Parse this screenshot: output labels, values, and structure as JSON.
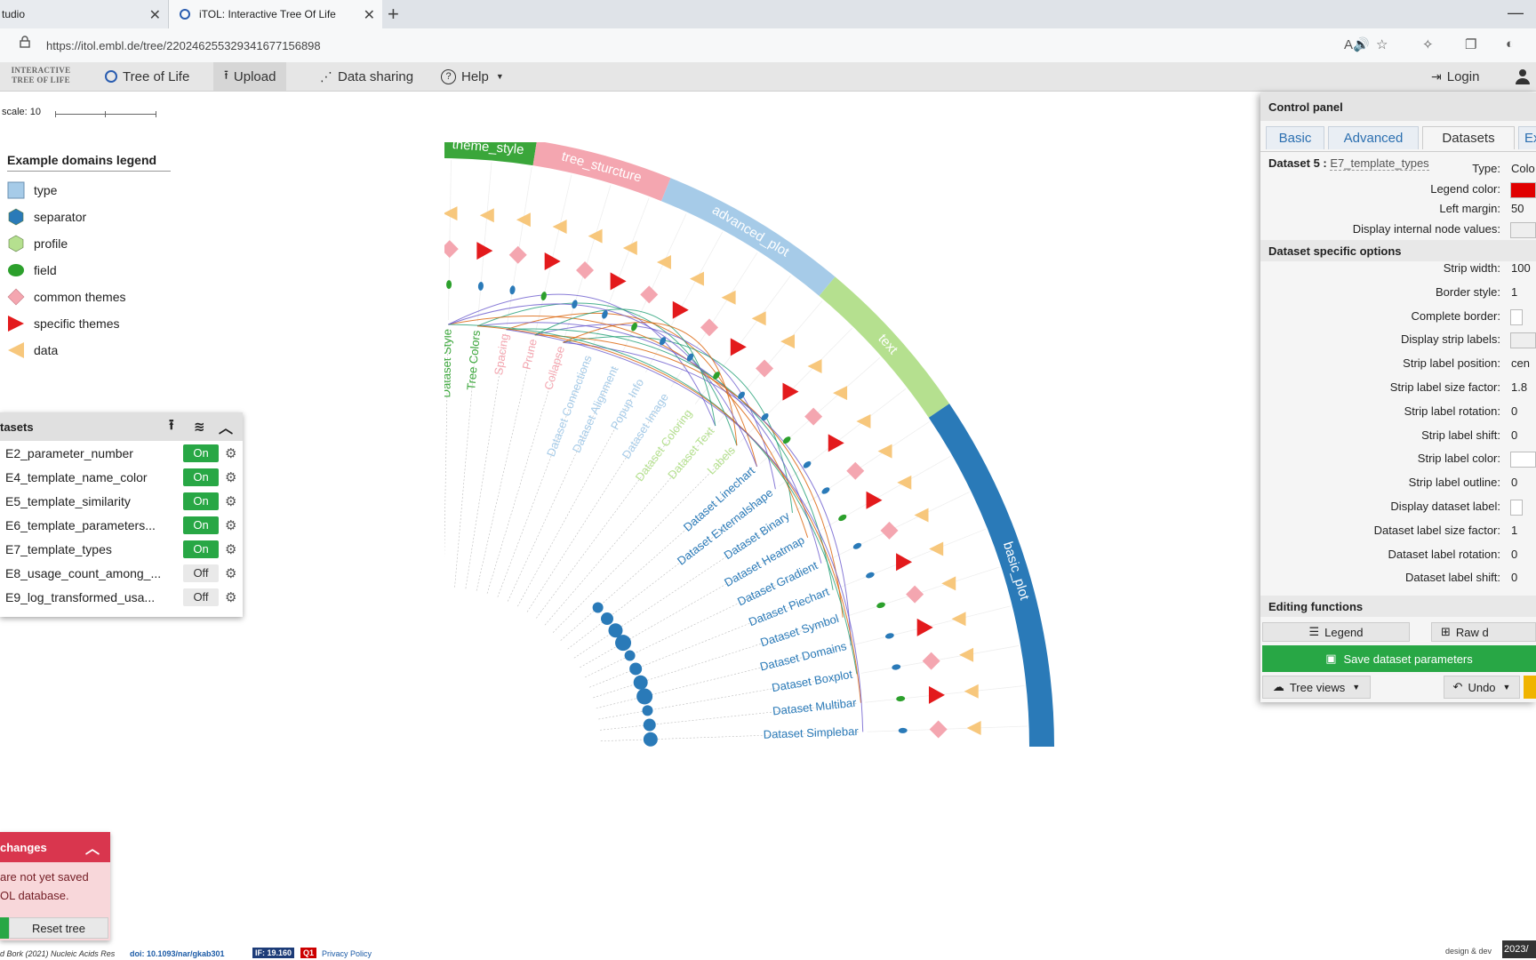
{
  "browser": {
    "tabs": [
      {
        "title": "tudio",
        "active": false
      },
      {
        "title": "iTOL: Interactive Tree Of Life",
        "active": true
      }
    ],
    "close_glyph": "✕",
    "newtab_glyph": "+",
    "minimize_glyph": "—",
    "url": "https://itol.embl.de/tree/220246255329341677156898"
  },
  "navbar": {
    "logo_line1": "Interactive",
    "logo_line2": "Tree Of Life",
    "items": [
      "Tree of Life",
      "Upload",
      "Data sharing",
      "Help"
    ],
    "login": "Login"
  },
  "scale": {
    "label": "scale: 10"
  },
  "legend": {
    "title": "Example domains legend",
    "items": [
      {
        "label": "type",
        "shape": "square",
        "color": "#a6cbe8"
      },
      {
        "label": "separator",
        "shape": "hexagon",
        "color": "#2a7ab8"
      },
      {
        "label": "profile",
        "shape": "hexagon",
        "color": "#b5e08f"
      },
      {
        "label": "field",
        "shape": "ellipse",
        "color": "#2ca02c"
      },
      {
        "label": "common themes",
        "shape": "diamond",
        "color": "#f4a6b0"
      },
      {
        "label": "specific themes",
        "shape": "triangle-right",
        "color": "#e31a1c"
      },
      {
        "label": "data",
        "shape": "triangle-left",
        "color": "#f7c77c"
      }
    ]
  },
  "datasets_panel": {
    "title": "tasets",
    "rows": [
      {
        "name": "E2_parameter_number",
        "state": "On"
      },
      {
        "name": "E4_template_name_color",
        "state": "On"
      },
      {
        "name": "E5_template_similarity",
        "state": "On"
      },
      {
        "name": "E6_template_parameters...",
        "state": "On"
      },
      {
        "name": "E7_template_types",
        "state": "On"
      },
      {
        "name": "E8_usage_count_among_...",
        "state": "Off"
      },
      {
        "name": "E9_log_transformed_usa...",
        "state": "Off"
      }
    ]
  },
  "changes_panel": {
    "title": "changes",
    "line1": "are not yet saved",
    "line2": "OL database.",
    "reset": "Reset tree"
  },
  "footer": {
    "citation": "d Bork (2021) Nucleic Acids Res",
    "doi": "doi: 10.1093/nar/gkab301",
    "impact": "IF: 19.160",
    "quartile": "Q1",
    "privacy": "Privacy Policy",
    "design": "design & dev",
    "stamp": "2023/"
  },
  "tree": {
    "ring_segments": [
      {
        "label": "theme_style",
        "color": "#3aa63a"
      },
      {
        "label": "tree_sturcture",
        "color": "#f4a6b0"
      },
      {
        "label": "advanced_plot",
        "color": "#a6cbe8"
      },
      {
        "label": "text",
        "color": "#b5e08f"
      },
      {
        "label": "basic_plot",
        "color": "#2a7ab8"
      }
    ],
    "leaves": [
      {
        "label": "Dataset Style",
        "color": "#3aa63a"
      },
      {
        "label": "Tree Colors",
        "color": "#3aa63a"
      },
      {
        "label": "Spacing",
        "color": "#f4a6b0"
      },
      {
        "label": "Prune",
        "color": "#f4a6b0"
      },
      {
        "label": "Collapse",
        "color": "#f4a6b0"
      },
      {
        "label": "Dataset Connections",
        "color": "#a6cbe8"
      },
      {
        "label": "Dataset Alignment",
        "color": "#a6cbe8"
      },
      {
        "label": "Popup Info",
        "color": "#a6cbe8"
      },
      {
        "label": "Dataset Image",
        "color": "#a6cbe8"
      },
      {
        "label": "Dataset Coloring",
        "color": "#b5e08f"
      },
      {
        "label": "Dataset Text",
        "color": "#b5e08f"
      },
      {
        "label": "Labels",
        "color": "#b5e08f"
      },
      {
        "label": "Dataset Linechart",
        "color": "#2a7ab8"
      },
      {
        "label": "Dataset Externalshape",
        "color": "#2a7ab8"
      },
      {
        "label": "Dataset Binary",
        "color": "#2a7ab8"
      },
      {
        "label": "Dataset Heatmap",
        "color": "#2a7ab8"
      },
      {
        "label": "Dataset Gradient",
        "color": "#2a7ab8"
      },
      {
        "label": "Dataset Piechart",
        "color": "#2a7ab8"
      },
      {
        "label": "Dataset Symbol",
        "color": "#2a7ab8"
      },
      {
        "label": "Dataset Domains",
        "color": "#2a7ab8"
      },
      {
        "label": "Dataset Boxplot",
        "color": "#2a7ab8"
      },
      {
        "label": "Dataset Multibar",
        "color": "#2a7ab8"
      },
      {
        "label": "Dataset Simplebar",
        "color": "#2a7ab8"
      }
    ]
  },
  "control_panel": {
    "title": "Control panel",
    "tabs": [
      "Basic",
      "Advanced",
      "Datasets",
      "Ex"
    ],
    "dataset_label": "Dataset 5 :",
    "dataset_name": "E7_template_types",
    "general": [
      {
        "label": "Type:",
        "value": "Colo"
      },
      {
        "label": "Legend color:",
        "value": ""
      },
      {
        "label": "Left margin:",
        "value": "50"
      },
      {
        "label": "Display internal node values:",
        "value": ""
      }
    ],
    "specific_title": "Dataset specific options",
    "specific": [
      {
        "label": "Strip width:",
        "value": "100"
      },
      {
        "label": "Border style:",
        "value": "1"
      },
      {
        "label": "Complete border:",
        "value": ""
      },
      {
        "label": "Display strip labels:",
        "value": ""
      },
      {
        "label": "Strip label position:",
        "value": "cen"
      },
      {
        "label": "Strip label size factor:",
        "value": "1.8"
      },
      {
        "label": "Strip label rotation:",
        "value": "0"
      },
      {
        "label": "Strip label shift:",
        "value": "0"
      },
      {
        "label": "Strip label color:",
        "value": ""
      },
      {
        "label": "Strip label outline:",
        "value": "0"
      },
      {
        "label": "Display dataset label:",
        "value": ""
      },
      {
        "label": "Dataset label size factor:",
        "value": "1"
      },
      {
        "label": "Dataset label rotation:",
        "value": "0"
      },
      {
        "label": "Dataset label shift:",
        "value": "0"
      }
    ],
    "editing_title": "Editing functions",
    "legend_btn": "Legend",
    "raw_btn": "Raw d",
    "save_btn": "Save dataset parameters",
    "treeviews_btn": "Tree views",
    "undo_btn": "Undo",
    "colors": {
      "legend_color": "#e00000",
      "save": "#28a745"
    }
  }
}
